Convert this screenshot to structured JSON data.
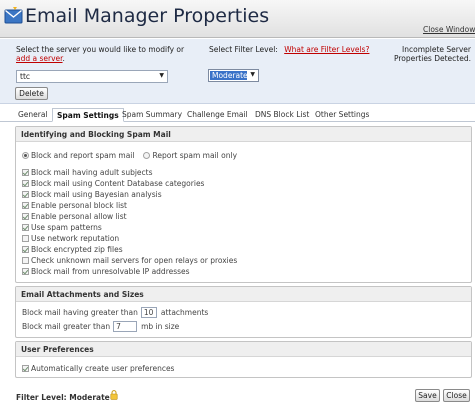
{
  "window": {
    "title": "Email Manager Properties",
    "close_label": "Close Window"
  },
  "server": {
    "prompt_line1": "Select the server you would like to modify or",
    "add_link": "add a server",
    "add_suffix": ".",
    "selected": "ttc",
    "filter_prompt": "Select Filter Level:",
    "filter_link": "What are Filter Levels?",
    "filter_selected": "Moderate",
    "status_line1": "Incomplete Server",
    "status_line2": "Properties Detected.",
    "delete_label": "Delete"
  },
  "tabs": [
    {
      "label": "General"
    },
    {
      "label": "Spam Settings",
      "active": true
    },
    {
      "label": "Spam Summary"
    },
    {
      "label": "Challenge Email"
    },
    {
      "label": "DNS Block List"
    },
    {
      "label": "Other Settings"
    }
  ],
  "spam": {
    "heading": "Identifying and Blocking Spam Mail",
    "radio_block": "Block and report spam mail",
    "radio_report": "Report spam mail only",
    "options": [
      {
        "label": "Block mail having adult subjects",
        "checked": true
      },
      {
        "label": "Block mail using Content Database categories",
        "checked": true
      },
      {
        "label": "Block mail using Bayesian analysis",
        "checked": true
      },
      {
        "label": "Enable personal block list",
        "checked": true
      },
      {
        "label": "Enable personal allow list",
        "checked": true
      },
      {
        "label": "Use spam patterns",
        "checked": true
      },
      {
        "label": "Use network reputation",
        "checked": false
      },
      {
        "label": "Block encrypted zip files",
        "checked": true
      },
      {
        "label": "Check unknown mail servers for open relays or proxies",
        "checked": false
      },
      {
        "label": "Block mail from unresolvable IP addresses",
        "checked": true
      }
    ]
  },
  "attachments": {
    "heading": "Email Attachments and Sizes",
    "row1_prefix": "Block mail having greater than",
    "row1_value": "10",
    "row1_suffix": "attachments",
    "row2_prefix": "Block mail greater than",
    "row2_value": "7",
    "row2_suffix": "mb in size"
  },
  "prefs": {
    "heading": "User Preferences",
    "auto_create": "Automatically create user preferences"
  },
  "footer": {
    "filter_level": "Filter Level: Moderate",
    "save_label": "Save",
    "close_label": "Close"
  },
  "colors": {
    "title_text": "#1e2a44",
    "link": "#c00000",
    "panel_bg": "#e8eef7",
    "select_highlight": "#3a72c8"
  }
}
